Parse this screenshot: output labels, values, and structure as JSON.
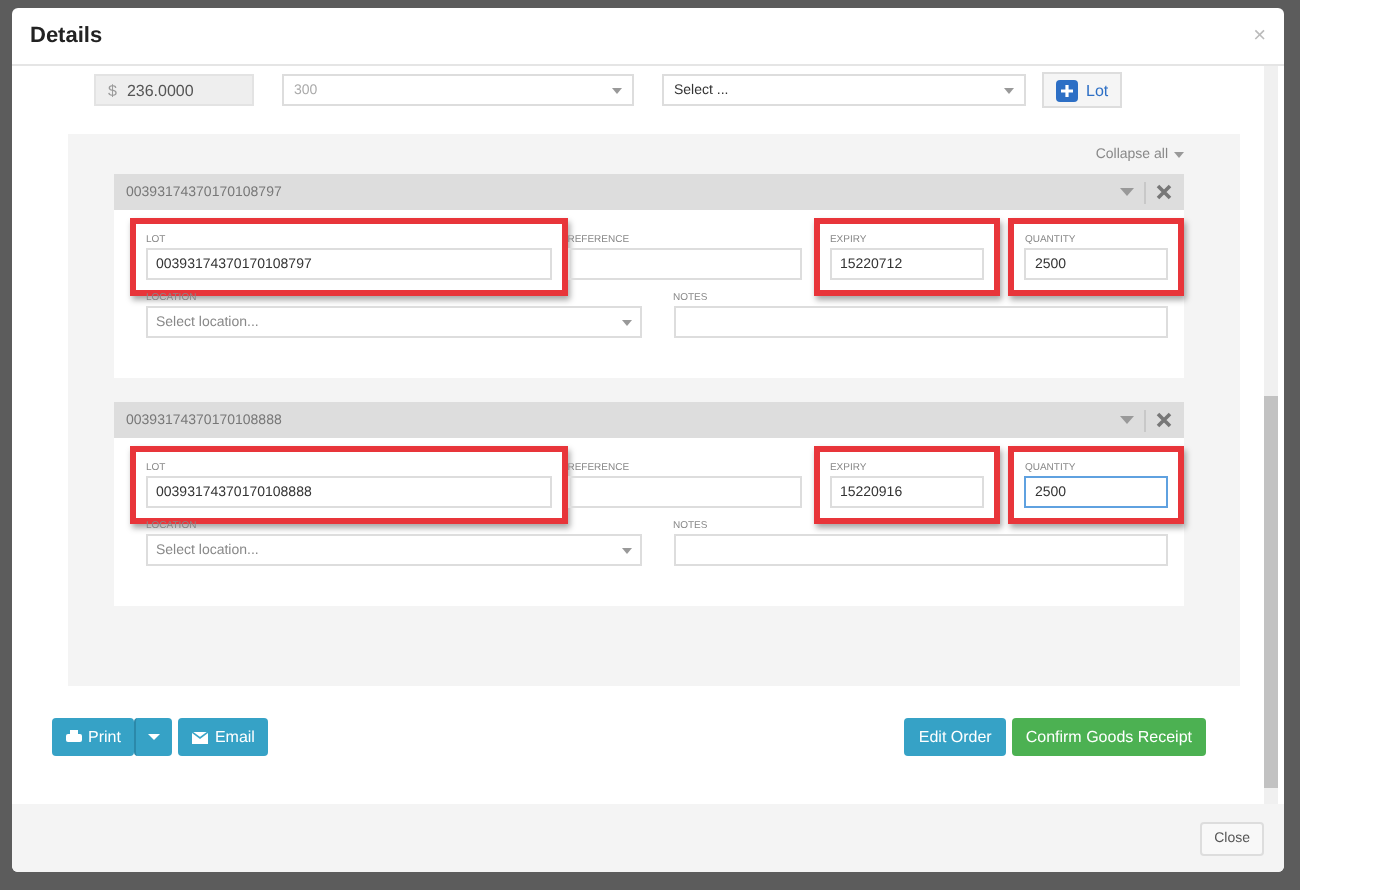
{
  "window": {
    "title": "Details",
    "close": "×"
  },
  "top_row": {
    "currency": "$",
    "price": "236.0000",
    "unit_select": "300",
    "select": "Select ...",
    "add_lot_button": "Lot"
  },
  "collapse_all": "Collapse all",
  "lots": [
    {
      "title": "00393174370170108797",
      "fields": {
        "lot": {
          "label": "LOT",
          "value": "00393174370170108797",
          "highlighted": true,
          "focused": false
        },
        "reference": {
          "label": "REFERENCE",
          "highlighted": false,
          "focused": false
        },
        "expiry": {
          "label": "EXPIRY",
          "value": "15220712",
          "highlighted": true,
          "focused": false
        },
        "quantity": {
          "label": "QUANTITY",
          "value": "2500",
          "highlighted": true,
          "focused": false
        }
      },
      "location": {
        "label": "LOCATION",
        "placeholder": "Select location..."
      },
      "notes": {
        "label": "NOTES"
      }
    },
    {
      "title": "00393174370170108888",
      "fields": {
        "lot": {
          "label": "LOT",
          "value": "00393174370170108888",
          "highlighted": true,
          "focused": false
        },
        "reference": {
          "label": "REFERENCE",
          "highlighted": false,
          "focused": false
        },
        "expiry": {
          "label": "EXPIRY",
          "value": "15220916",
          "highlighted": true,
          "focused": false
        },
        "quantity": {
          "label": "QUANTITY",
          "value": "2500",
          "highlighted": true,
          "focused": true
        }
      },
      "location": {
        "label": "LOCATION",
        "placeholder": "Select location..."
      },
      "notes": {
        "label": "NOTES"
      }
    }
  ],
  "actions": {
    "print": "Print",
    "email": "Email",
    "edit_order": "Edit Order",
    "confirm": "Confirm Goods Receipt"
  },
  "footer": {
    "close": "Close"
  }
}
